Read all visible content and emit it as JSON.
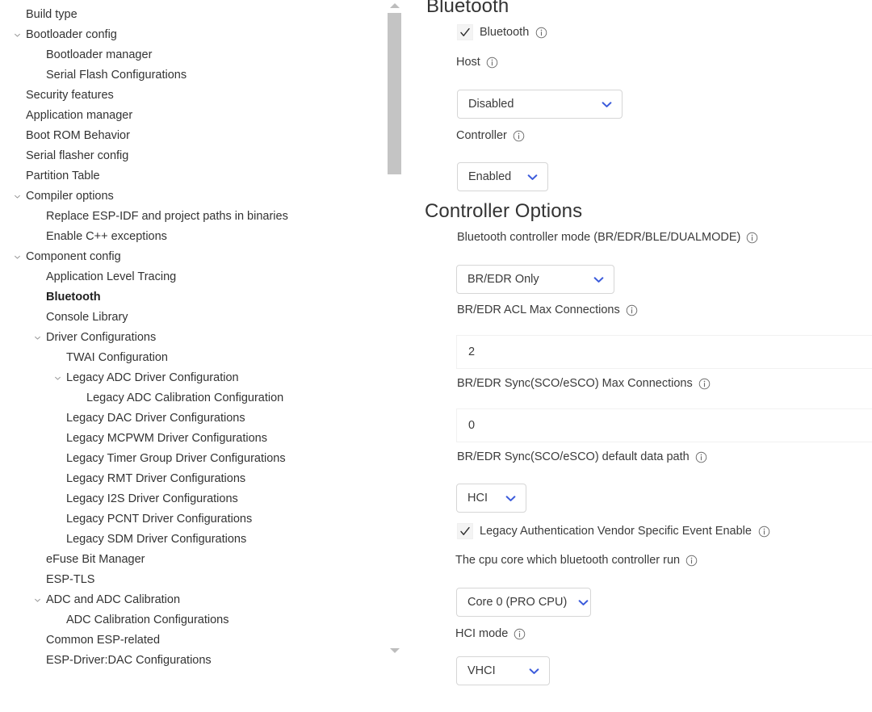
{
  "sidebar": {
    "items": [
      {
        "label": "Build type",
        "indent": 0,
        "twisty": "none",
        "selected": false
      },
      {
        "label": "Bootloader config",
        "indent": 0,
        "twisty": "down",
        "selected": false
      },
      {
        "label": "Bootloader manager",
        "indent": 1,
        "twisty": "none",
        "selected": false
      },
      {
        "label": "Serial Flash Configurations",
        "indent": 1,
        "twisty": "none",
        "selected": false
      },
      {
        "label": "Security features",
        "indent": 0,
        "twisty": "none",
        "selected": false
      },
      {
        "label": "Application manager",
        "indent": 0,
        "twisty": "none",
        "selected": false
      },
      {
        "label": "Boot ROM Behavior",
        "indent": 0,
        "twisty": "none",
        "selected": false
      },
      {
        "label": "Serial flasher config",
        "indent": 0,
        "twisty": "none",
        "selected": false
      },
      {
        "label": "Partition Table",
        "indent": 0,
        "twisty": "none",
        "selected": false
      },
      {
        "label": "Compiler options",
        "indent": 0,
        "twisty": "down",
        "selected": false
      },
      {
        "label": "Replace ESP-IDF and project paths in binaries",
        "indent": 1,
        "twisty": "none",
        "selected": false
      },
      {
        "label": "Enable C++ exceptions",
        "indent": 1,
        "twisty": "none",
        "selected": false
      },
      {
        "label": "Component config",
        "indent": 0,
        "twisty": "down",
        "selected": false
      },
      {
        "label": "Application Level Tracing",
        "indent": 1,
        "twisty": "none",
        "selected": false
      },
      {
        "label": "Bluetooth",
        "indent": 1,
        "twisty": "none",
        "selected": true
      },
      {
        "label": "Console Library",
        "indent": 1,
        "twisty": "none",
        "selected": false
      },
      {
        "label": "Driver Configurations",
        "indent": 1,
        "twisty": "down",
        "selected": false
      },
      {
        "label": "TWAI Configuration",
        "indent": 2,
        "twisty": "none",
        "selected": false
      },
      {
        "label": "Legacy ADC Driver Configuration",
        "indent": 2,
        "twisty": "down",
        "selected": false
      },
      {
        "label": "Legacy ADC Calibration Configuration",
        "indent": 3,
        "twisty": "none",
        "selected": false
      },
      {
        "label": "Legacy DAC Driver Configurations",
        "indent": 2,
        "twisty": "none",
        "selected": false
      },
      {
        "label": "Legacy MCPWM Driver Configurations",
        "indent": 2,
        "twisty": "none",
        "selected": false
      },
      {
        "label": "Legacy Timer Group Driver Configurations",
        "indent": 2,
        "twisty": "none",
        "selected": false
      },
      {
        "label": "Legacy RMT Driver Configurations",
        "indent": 2,
        "twisty": "none",
        "selected": false
      },
      {
        "label": "Legacy I2S Driver Configurations",
        "indent": 2,
        "twisty": "none",
        "selected": false
      },
      {
        "label": "Legacy PCNT Driver Configurations",
        "indent": 2,
        "twisty": "none",
        "selected": false
      },
      {
        "label": "Legacy SDM Driver Configurations",
        "indent": 2,
        "twisty": "none",
        "selected": false
      },
      {
        "label": "eFuse Bit Manager",
        "indent": 1,
        "twisty": "none",
        "selected": false
      },
      {
        "label": "ESP-TLS",
        "indent": 1,
        "twisty": "none",
        "selected": false
      },
      {
        "label": "ADC and ADC Calibration",
        "indent": 1,
        "twisty": "down",
        "selected": false
      },
      {
        "label": "ADC Calibration Configurations",
        "indent": 2,
        "twisty": "none",
        "selected": false
      },
      {
        "label": "Common ESP-related",
        "indent": 1,
        "twisty": "none",
        "selected": false
      },
      {
        "label": "ESP-Driver:DAC Configurations",
        "indent": 1,
        "twisty": "none",
        "selected": false
      }
    ]
  },
  "scrollbar": {
    "up_arrow": "scroll-up-arrow",
    "down_arrow": "scroll-down-arrow",
    "thumb": "scroll-thumb"
  },
  "detail": {
    "title_bluetooth": "Bluetooth",
    "title_controller_options": "Controller Options",
    "bluetooth_checkbox": {
      "label": "Bluetooth",
      "checked": true,
      "info": "info-icon"
    },
    "host": {
      "label": "Host",
      "value": "Disabled"
    },
    "controller": {
      "label": "Controller",
      "value": "Enabled"
    },
    "controller_mode": {
      "label": "Bluetooth controller mode (BR/EDR/BLE/DUALMODE)",
      "value": "BR/EDR Only"
    },
    "acl_max_connections": {
      "label": "BR/EDR ACL Max Connections",
      "value": "2"
    },
    "sync_max_connections": {
      "label": "BR/EDR Sync(SCO/eSCO) Max Connections",
      "value": "0"
    },
    "sync_data_path": {
      "label": "BR/EDR Sync(SCO/eSCO) default data path",
      "value": "HCI"
    },
    "legacy_auth_checkbox": {
      "label": "Legacy Authentication Vendor Specific Event Enable",
      "checked": true
    },
    "cpu_core": {
      "label": "The cpu core which bluetooth controller run",
      "value": "Core 0 (PRO CPU)"
    },
    "hci_mode": {
      "label": "HCI mode",
      "value": "VHCI"
    }
  },
  "colors": {
    "accent_chevron": "#3b5bdb",
    "text": "#3b3b3b",
    "border": "#d6d6d6",
    "scrollbar_thumb": "#c4c4c4"
  }
}
